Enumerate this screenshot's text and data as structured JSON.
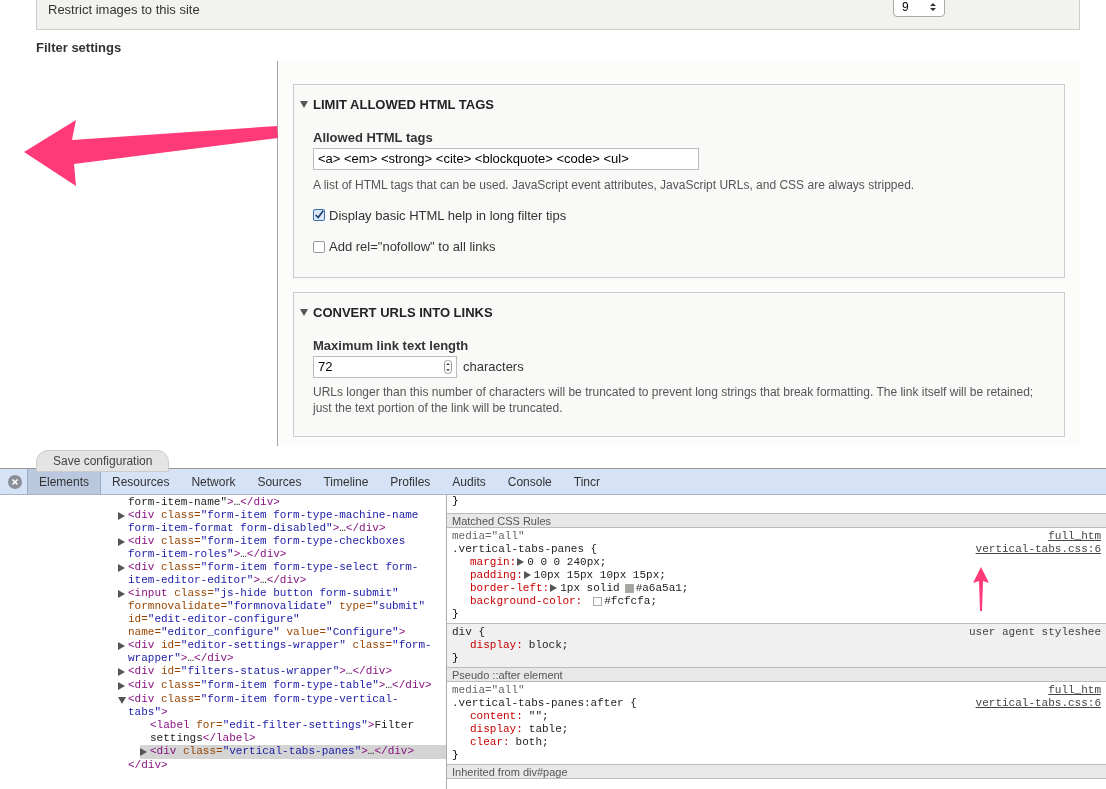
{
  "page": {
    "top_box": {
      "label": "Restrict images to this site",
      "select_value": "9"
    },
    "section_title": "Filter settings",
    "fieldsets": [
      {
        "title": "LIMIT ALLOWED HTML TAGS",
        "expanded": true,
        "items": [
          {
            "kind": "text_field",
            "label": "Allowed HTML tags",
            "value": "<a> <em> <strong> <cite> <blockquote> <code> <ul>",
            "description": "A list of HTML tags that can be used. JavaScript event attributes, JavaScript URLs, and CSS are always stripped."
          },
          {
            "kind": "checkbox",
            "label": "Display basic HTML help in long filter tips",
            "checked": true
          },
          {
            "kind": "checkbox",
            "label": "Add rel=\"nofollow\" to all links",
            "checked": false
          }
        ]
      },
      {
        "title": "CONVERT URLS INTO LINKS",
        "expanded": true,
        "items": [
          {
            "kind": "number_field",
            "label": "Maximum link text length",
            "value": "72",
            "suffix": "characters",
            "description": "URLs longer than this number of characters will be truncated to prevent long strings that break formatting. The link itself will be retained; just the text portion of the link will be truncated."
          }
        ]
      }
    ],
    "save_button": "Save configuration"
  },
  "devtools": {
    "tabs": [
      {
        "label": "Elements",
        "selected": true
      },
      {
        "label": "Resources",
        "selected": false
      },
      {
        "label": "Network",
        "selected": false
      },
      {
        "label": "Sources",
        "selected": false
      },
      {
        "label": "Timeline",
        "selected": false
      },
      {
        "label": "Profiles",
        "selected": false
      },
      {
        "label": "Audits",
        "selected": false
      },
      {
        "label": "Console",
        "selected": false
      },
      {
        "label": "Tincr",
        "selected": false
      }
    ],
    "dom_tree": [
      {
        "kind": "fragment",
        "markup": "form-item-name\">…</div>"
      },
      {
        "kind": "element",
        "markup": "<div class=\"form-item form-type-machine-name form-item-format form-disabled\">…</div>",
        "expanded": false,
        "selected": false
      },
      {
        "kind": "element",
        "markup": "<div class=\"form-item form-type-checkboxes form-item-roles\">…</div>",
        "expanded": false,
        "selected": false
      },
      {
        "kind": "element",
        "markup": "<div class=\"form-item form-type-select form-item-editor-editor\">…</div>",
        "expanded": false,
        "selected": false
      },
      {
        "kind": "element",
        "markup": "<input class=\"js-hide button form-submit\" formnovalidate=\"formnovalidate\" type=\"submit\" id=\"edit-editor-configure\" name=\"editor_configure\" value=\"Configure\">",
        "expanded": false,
        "selected": false
      },
      {
        "kind": "element",
        "markup": "<div id=\"editor-settings-wrapper\" class=\"form-wrapper\">…</div>",
        "expanded": false,
        "selected": false
      },
      {
        "kind": "element",
        "markup": "<div id=\"filters-status-wrapper\">…</div>",
        "expanded": false,
        "selected": false
      },
      {
        "kind": "element",
        "markup": "<div class=\"form-item form-type-table\">…</div>",
        "expanded": false,
        "selected": false
      },
      {
        "kind": "element",
        "markup": "<div class=\"form-item form-type-vertical-tabs\">",
        "expanded": true,
        "selected": false,
        "close": "</div>",
        "children": [
          {
            "kind": "fragment",
            "markup": "<label for=\"edit-filter-settings\">Filter settings</label>"
          },
          {
            "kind": "element",
            "markup": "<div class=\"vertical-tabs-panes\">…</div>",
            "expanded": false,
            "selected": true
          }
        ]
      }
    ],
    "styles": [
      {
        "kind": "line",
        "text": "}"
      },
      {
        "kind": "header",
        "text": "Matched CSS Rules"
      },
      {
        "kind": "rule",
        "user_agent": false,
        "media": "media=\"all\"",
        "media_source": "full_htm",
        "selector": ".vertical-tabs-panes {",
        "source": "vertical-tabs.css:6",
        "properties": [
          {
            "name": "margin:",
            "value": "0 0 0 240px;",
            "expandable": true
          },
          {
            "name": "padding:",
            "value": "10px 15px 10px 15px;",
            "expandable": true
          },
          {
            "name": "border-left:",
            "value": "1px solid",
            "color_value": "#a6a5a1;",
            "expandable": true
          },
          {
            "name": "background-color:",
            "color_value": "#fcfcfa;",
            "expandable": false
          }
        ],
        "close": "}"
      },
      {
        "kind": "rule",
        "user_agent": true,
        "selector": "div {",
        "source": "user agent styleshee",
        "properties": [
          {
            "name": "display:",
            "value": "block;",
            "expandable": false
          }
        ],
        "close": "}"
      },
      {
        "kind": "header",
        "text": "Pseudo ::after element"
      },
      {
        "kind": "rule",
        "user_agent": false,
        "media": "media=\"all\"",
        "media_source": "full_htm",
        "selector": ".vertical-tabs-panes:after {",
        "source": "vertical-tabs.css:6",
        "properties": [
          {
            "name": "content:",
            "value": "\"\";",
            "expandable": false
          },
          {
            "name": "display:",
            "value": "table;",
            "expandable": false
          },
          {
            "name": "clear:",
            "value": "both;",
            "expandable": false
          }
        ],
        "close": "}"
      },
      {
        "kind": "header",
        "text": "Inherited from div#page"
      }
    ]
  }
}
